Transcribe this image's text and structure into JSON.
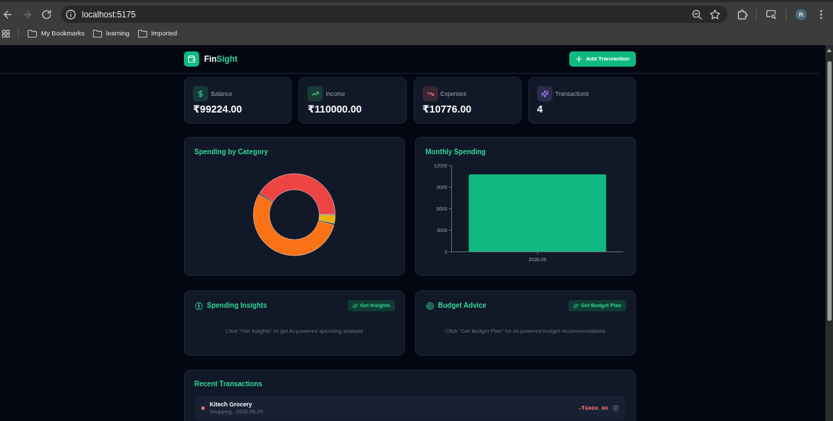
{
  "browser": {
    "nav_buttons": [
      {
        "kind": "back",
        "disabled": false
      },
      {
        "kind": "forward",
        "disabled": true
      },
      {
        "kind": "reload",
        "disabled": false
      }
    ],
    "url": "localhost:5175",
    "profile_initial": "R",
    "bookmarks": [
      "My Bookmarks",
      "learning",
      "Imported"
    ]
  },
  "header": {
    "brand": {
      "text": "Fin",
      "accent": "Sight"
    },
    "action": "Add Transaction"
  },
  "stats": [
    {
      "kind": "balance",
      "label": "Balance",
      "value": "₹99224.00"
    },
    {
      "kind": "income",
      "label": "Income",
      "value": "₹110000.00"
    },
    {
      "kind": "expenses",
      "label": "Expenses",
      "value": "₹10776.00"
    },
    {
      "kind": "count",
      "label": "Transactions",
      "value": "4"
    }
  ],
  "category_chart": {
    "title": "Spending by Category"
  },
  "monthly_chart": {
    "chart_data": {
      "type": "bar",
      "title": "Monthly Spending",
      "categories": [
        "2026-05"
      ],
      "values": [
        10800
      ],
      "ylim": [
        0,
        12000
      ],
      "yticks": [
        0,
        3000,
        6000,
        9000,
        12000
      ]
    }
  },
  "ai_panels": [
    {
      "kind": "insights",
      "title": "Spending Insights",
      "button": "Get Insights",
      "message": "Click \"Get Insights\" to get AI-powered spending analysis"
    },
    {
      "kind": "budget",
      "title": "Budget Advice",
      "button": "Get Budget Plan",
      "message": "Click \"Get Budget Plan\" for AI-powered budget recommendations"
    }
  ],
  "recent_transactions": {
    "title": "Recent Transactions",
    "items": [
      {
        "color": "#f87171",
        "name": "Kitech Grocery",
        "details": "Shopping - 2026-05-29",
        "amount": "-₹6000.00"
      }
    ]
  }
}
